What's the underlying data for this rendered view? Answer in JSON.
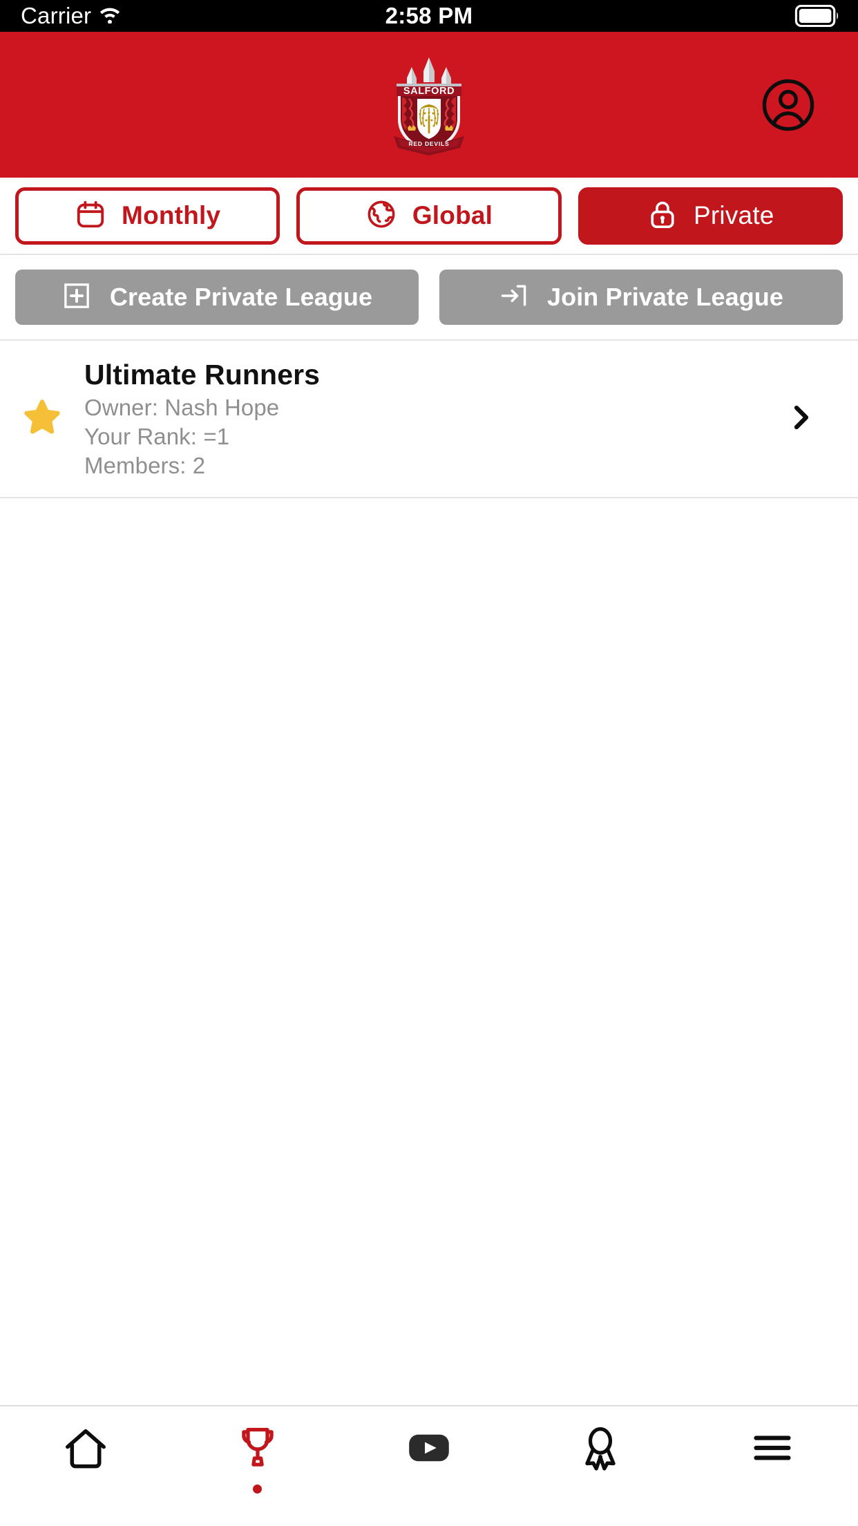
{
  "status_bar": {
    "carrier": "Carrier",
    "time": "2:58 PM",
    "wifi_icon": "wifi-icon",
    "battery_icon": "battery-icon"
  },
  "header": {
    "logo_alt": "Salford Red Devils",
    "logo_top_text": "SALFORD",
    "logo_bottom_text": "RED DEVILS",
    "profile_icon": "user-circle-icon",
    "background_color": "#CE1620"
  },
  "tabs": [
    {
      "label": "Monthly",
      "icon": "calendar-icon",
      "active": false
    },
    {
      "label": "Global",
      "icon": "globe-icon",
      "active": false
    },
    {
      "label": "Private",
      "icon": "lock-icon",
      "active": true
    }
  ],
  "actions": [
    {
      "label": "Create Private League",
      "icon": "plus-square-icon"
    },
    {
      "label": "Join Private League",
      "icon": "login-arrow-icon"
    }
  ],
  "leagues": [
    {
      "name": "Ultimate Runners",
      "owner": "Owner: Nash Hope",
      "rank": "Your Rank: =1",
      "members": "Members: 2",
      "favourite_icon": "star-icon",
      "chevron_icon": "chevron-right-icon"
    }
  ],
  "bottom_nav": [
    {
      "icon": "home-icon",
      "active": false
    },
    {
      "icon": "trophy-icon",
      "active": true
    },
    {
      "icon": "play-video-icon",
      "active": false
    },
    {
      "icon": "award-ribbon-icon",
      "active": false
    },
    {
      "icon": "hamburger-menu-icon",
      "active": false
    }
  ],
  "colors": {
    "brand_red": "#CE1620",
    "tab_red": "#C0161C",
    "action_gray": "#9a9a9a",
    "star_gold": "#F5C037",
    "meta_gray": "#8f8f8f"
  }
}
